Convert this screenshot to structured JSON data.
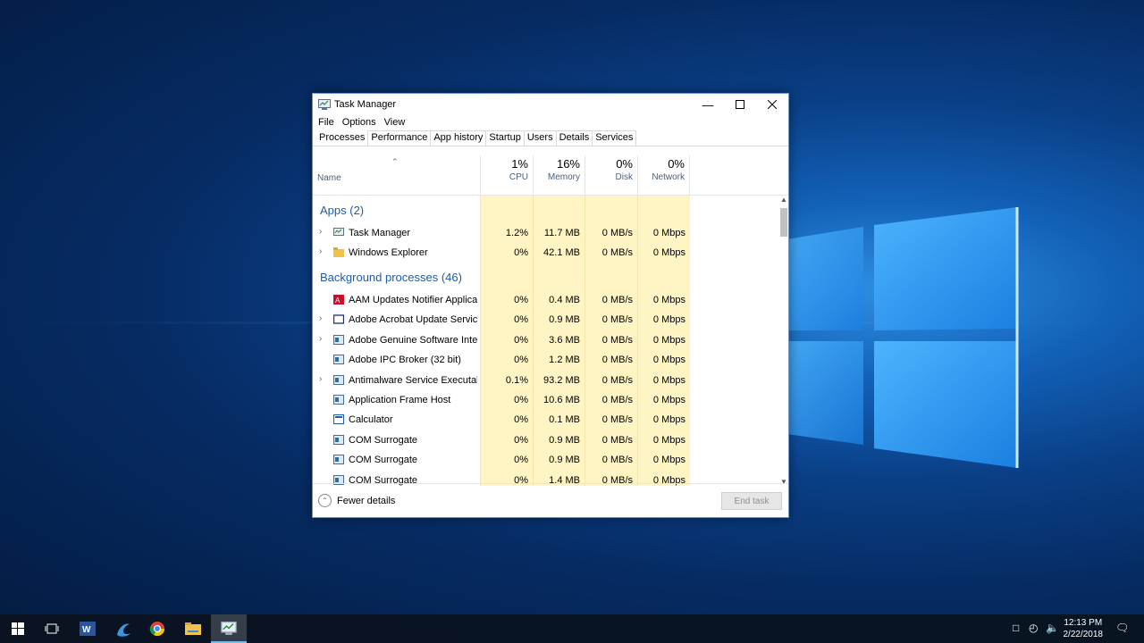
{
  "window": {
    "title": "Task Manager",
    "menu": [
      "File",
      "Options",
      "View"
    ],
    "tabs": [
      "Processes",
      "Performance",
      "App history",
      "Startup",
      "Users",
      "Details",
      "Services"
    ],
    "active_tab": "Processes"
  },
  "columns": {
    "name": "Name",
    "cpu": {
      "pct": "1%",
      "label": "CPU"
    },
    "memory": {
      "pct": "16%",
      "label": "Memory"
    },
    "disk": {
      "pct": "0%",
      "label": "Disk"
    },
    "network": {
      "pct": "0%",
      "label": "Network"
    }
  },
  "groups": {
    "apps": "Apps (2)",
    "background": "Background processes (46)"
  },
  "apps": [
    {
      "name": "Task Manager",
      "cpu": "1.2%",
      "memory": "11.7 MB",
      "disk": "0 MB/s",
      "network": "0 Mbps",
      "expandable": true,
      "icon": "task-manager-icon"
    },
    {
      "name": "Windows Explorer",
      "cpu": "0%",
      "memory": "42.1 MB",
      "disk": "0 MB/s",
      "network": "0 Mbps",
      "expandable": true,
      "icon": "folder-icon"
    }
  ],
  "background": [
    {
      "name": "AAM Updates Notifier Applicati...",
      "cpu": "0%",
      "memory": "0.4 MB",
      "disk": "0 MB/s",
      "network": "0 Mbps",
      "expandable": false,
      "icon": "adobe-icon"
    },
    {
      "name": "Adobe Acrobat Update Service (...",
      "cpu": "0%",
      "memory": "0.9 MB",
      "disk": "0 MB/s",
      "network": "0 Mbps",
      "expandable": true,
      "icon": "window-icon"
    },
    {
      "name": "Adobe Genuine Software Integri...",
      "cpu": "0%",
      "memory": "3.6 MB",
      "disk": "0 MB/s",
      "network": "0 Mbps",
      "expandable": true,
      "icon": "service-icon"
    },
    {
      "name": "Adobe IPC Broker (32 bit)",
      "cpu": "0%",
      "memory": "1.2 MB",
      "disk": "0 MB/s",
      "network": "0 Mbps",
      "expandable": false,
      "icon": "service-icon"
    },
    {
      "name": "Antimalware Service Executable",
      "cpu": "0.1%",
      "memory": "93.2 MB",
      "disk": "0 MB/s",
      "network": "0 Mbps",
      "expandable": true,
      "icon": "service-icon"
    },
    {
      "name": "Application Frame Host",
      "cpu": "0%",
      "memory": "10.6 MB",
      "disk": "0 MB/s",
      "network": "0 Mbps",
      "expandable": false,
      "icon": "service-icon"
    },
    {
      "name": "Calculator",
      "cpu": "0%",
      "memory": "0.1 MB",
      "disk": "0 MB/s",
      "network": "0 Mbps",
      "expandable": false,
      "icon": "calculator-icon"
    },
    {
      "name": "COM Surrogate",
      "cpu": "0%",
      "memory": "0.9 MB",
      "disk": "0 MB/s",
      "network": "0 Mbps",
      "expandable": false,
      "icon": "service-icon"
    },
    {
      "name": "COM Surrogate",
      "cpu": "0%",
      "memory": "0.9 MB",
      "disk": "0 MB/s",
      "network": "0 Mbps",
      "expandable": false,
      "icon": "service-icon"
    },
    {
      "name": "COM Surrogate",
      "cpu": "0%",
      "memory": "1.4 MB",
      "disk": "0 MB/s",
      "network": "0 Mbps",
      "expandable": false,
      "icon": "service-icon"
    }
  ],
  "footer": {
    "fewer_details": "Fewer details",
    "end_task": "End task"
  },
  "taskbar": {
    "items": [
      "start-icon",
      "task-view-icon",
      "word-icon",
      "edge-icon",
      "chrome-icon",
      "file-explorer-icon",
      "task-manager-icon"
    ],
    "time": "12:13 PM",
    "date": "2/22/2018"
  }
}
